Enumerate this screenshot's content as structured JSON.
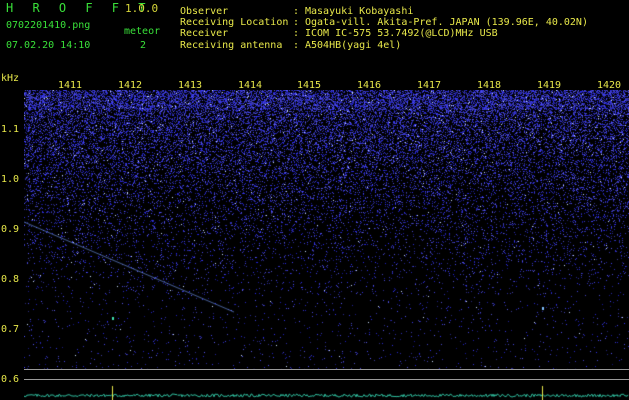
{
  "header": {
    "app_title": "H R O F F T",
    "version": "1.0.0",
    "filename": "0702201410.png",
    "datetime": "07.02.20 14:10",
    "meteor_label": "meteor",
    "meteor_count": "2"
  },
  "info": [
    {
      "key": "Observer",
      "sep": ":",
      "value": "Masayuki Kobayashi"
    },
    {
      "key": "Receiving Location",
      "sep": ":",
      "value": "Ogata-vill. Akita-Pref. JAPAN (139.96E, 40.02N)"
    },
    {
      "key": "Receiver",
      "sep": ":",
      "value": "ICOM IC-575 53.7492(@LCD)MHz USB"
    },
    {
      "key": "Receiving antenna",
      "sep": ":",
      "value": "A504HB(yagi 4el)"
    }
  ],
  "axis": {
    "y_unit": "kHz",
    "y_ticks": [
      "1.1",
      "1.0",
      "0.9",
      "0.8",
      "0.7",
      "0.6"
    ],
    "x_ticks": [
      "1411",
      "1412",
      "1413",
      "1414",
      "1415",
      "1416",
      "1417",
      "1418",
      "1419",
      "1420"
    ]
  },
  "colors": {
    "background": "#000000",
    "noise": "#2a3cff",
    "label_yellow": "#e8e84a",
    "label_green": "#39e039",
    "trace": "#30c0a0"
  }
}
